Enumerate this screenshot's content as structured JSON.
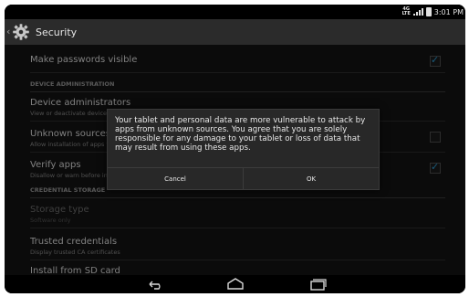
{
  "status_bar": {
    "network_label_top": "4G",
    "network_label_bottom": "LTE",
    "time": "3:01 PM"
  },
  "app_bar": {
    "title": "Security",
    "icon": "gear-icon"
  },
  "settings": {
    "make_passwords_visible": {
      "title": "Make passwords visible",
      "checked": true
    },
    "device_administration_header": "DEVICE ADMINISTRATION",
    "device_administrators": {
      "title": "Device administrators",
      "subtitle": "View or deactivate device administrators"
    },
    "unknown_sources": {
      "title": "Unknown sources",
      "subtitle": "Allow installation of apps from unknown sources",
      "checked": false
    },
    "verify_apps": {
      "title": "Verify apps",
      "subtitle": "Disallow or warn before installation of apps that may cause harm",
      "checked": true
    },
    "credential_storage_header": "CREDENTIAL STORAGE",
    "storage_type": {
      "title": "Storage type",
      "subtitle": "Software only"
    },
    "trusted_credentials": {
      "title": "Trusted credentials",
      "subtitle": "Display trusted CA certificates"
    },
    "install_from_sd": {
      "title": "Install from SD card"
    }
  },
  "dialog": {
    "message": "Your tablet and personal data are more vulnerable to attack by apps from unknown sources. You agree that you are solely responsible for any damage to your tablet or loss of data that may result from using these apps.",
    "cancel_label": "Cancel",
    "ok_label": "OK"
  },
  "navigation": {
    "back_icon": "back-icon",
    "home_icon": "home-icon",
    "recents_icon": "recents-icon"
  },
  "colors": {
    "accent": "#2d9ad1",
    "app_bar": "#2b2b2b",
    "dialog": "#282828"
  }
}
